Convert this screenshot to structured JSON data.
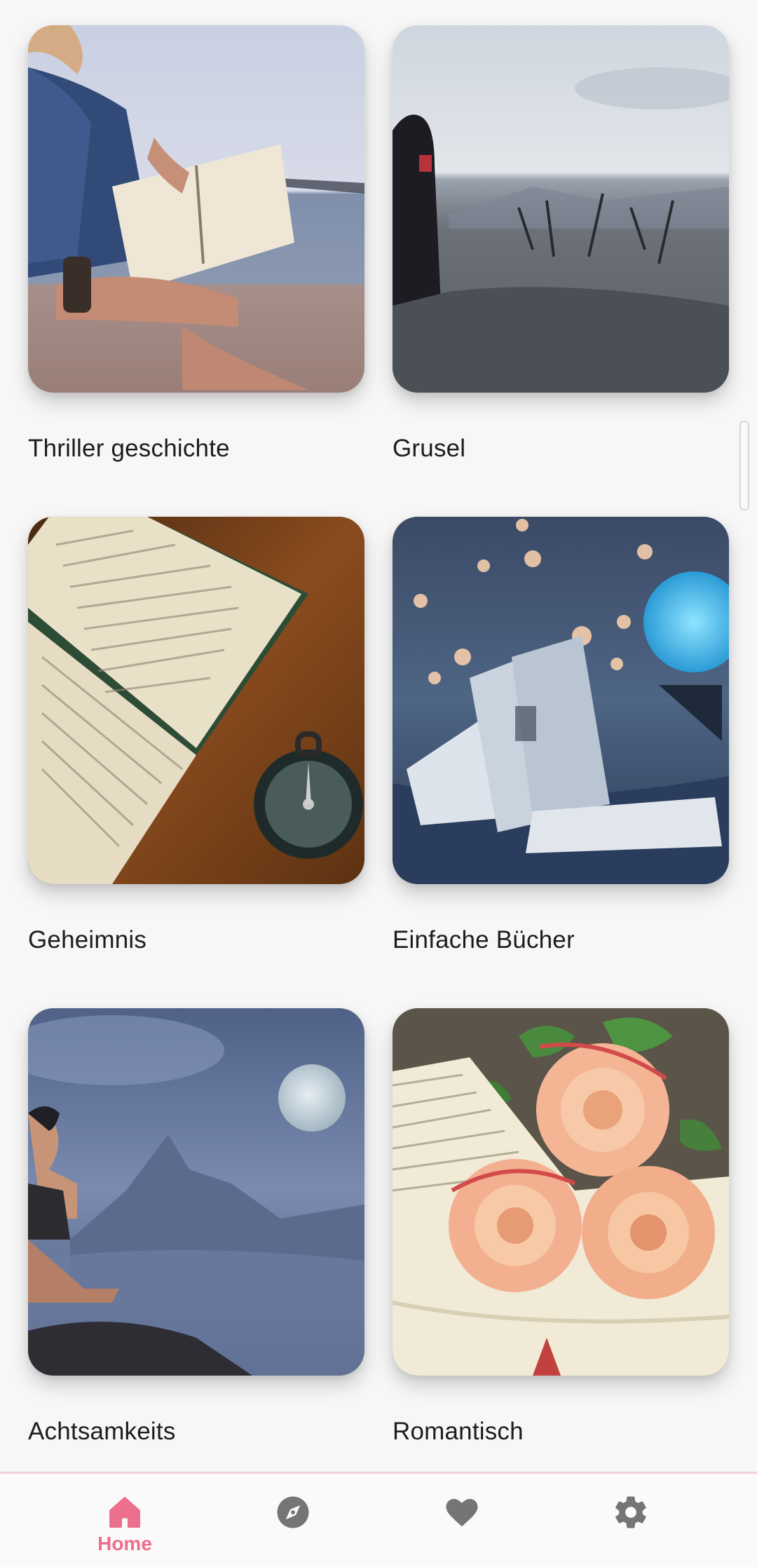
{
  "categories": [
    {
      "title": "Thriller geschichte",
      "image": "woman-reading-book-by-lake"
    },
    {
      "title": "Grusel",
      "image": "hooded-witch-with-skull-in-burnt-field"
    },
    {
      "title": "Geheimnis",
      "image": "open-old-book-with-compass"
    },
    {
      "title": "Einfache Bücher",
      "image": "open-book-with-bokeh-lights-and-moon-lamp"
    },
    {
      "title": "Achtsamkeits",
      "image": "man-meditating-under-full-moon"
    },
    {
      "title": "Romantisch",
      "image": "roses-on-open-book"
    }
  ],
  "bottom_nav": {
    "items": [
      {
        "id": "home",
        "icon": "home-icon",
        "label": "Home",
        "active": true
      },
      {
        "id": "explore",
        "icon": "compass-icon",
        "label": "",
        "active": false
      },
      {
        "id": "favorites",
        "icon": "heart-icon",
        "label": "",
        "active": false
      },
      {
        "id": "settings",
        "icon": "gear-icon",
        "label": "",
        "active": false
      }
    ]
  },
  "colors": {
    "accent": "#ec6f8d",
    "inactive_icon": "#757575",
    "background": "#f7f7f7",
    "text": "#1d1d1d"
  }
}
